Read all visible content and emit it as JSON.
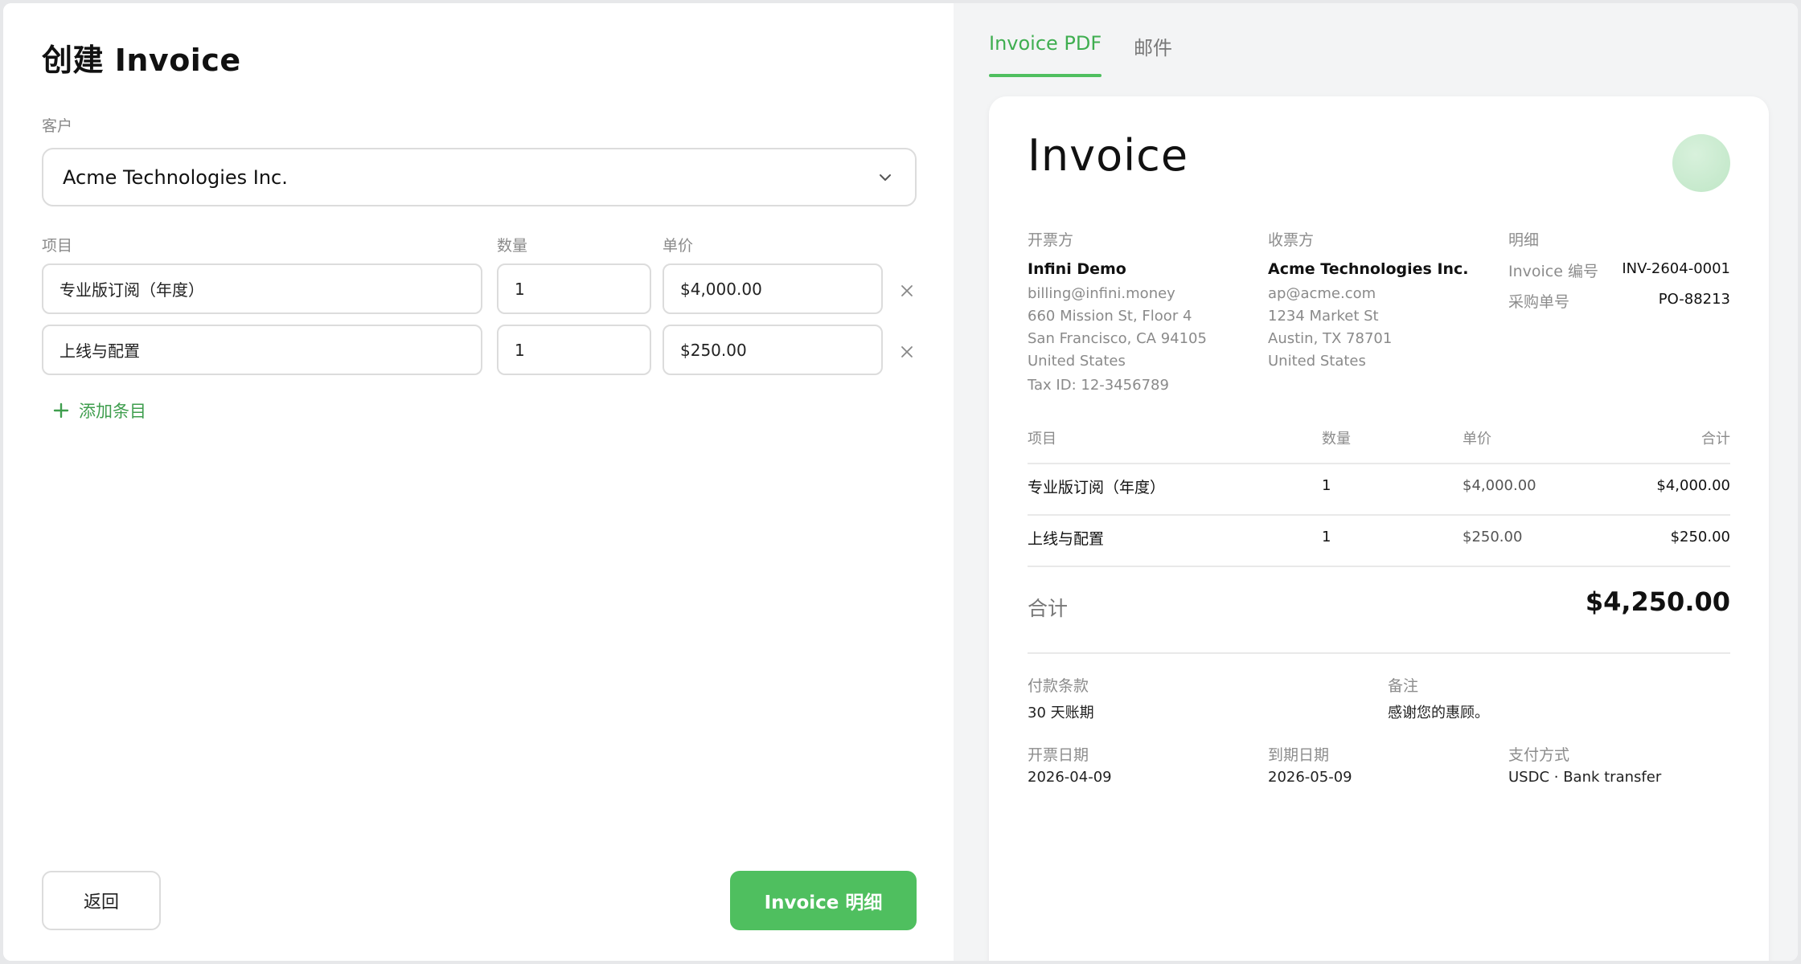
{
  "form": {
    "title": "创建 Invoice",
    "customer_label": "客户",
    "customer_value": "Acme Technologies Inc.",
    "col_item": "项目",
    "col_qty": "数量",
    "col_unit_price": "单价",
    "rows": [
      {
        "item": "专业版订阅（年度）",
        "qty": "1",
        "price": "$4,000.00"
      },
      {
        "item": "上线与配置",
        "qty": "1",
        "price": "$250.00"
      }
    ],
    "add_item_label": "添加条目",
    "back_label": "返回",
    "primary_label": "Invoice 明细"
  },
  "preview": {
    "tabs": [
      "Invoice PDF",
      "邮件"
    ],
    "active_tab": "Invoice PDF",
    "title": "Invoice",
    "from": {
      "heading": "开票方",
      "name": "Infini Demo",
      "lines": [
        "billing@infini.money",
        "660 Mission St, Floor 4",
        "San Francisco, CA 94105",
        "United States",
        "Tax ID: 12-3456789"
      ]
    },
    "to": {
      "heading": "收票方",
      "name": "Acme Technologies Inc.",
      "lines": [
        "ap@acme.com",
        "1234 Market St",
        "Austin, TX 78701",
        "United States"
      ]
    },
    "details": {
      "heading": "明细",
      "invoice_no_label": "Invoice 编号",
      "invoice_no": "INV-2604-0001",
      "po_label": "采购单号",
      "po": "PO-88213"
    },
    "table": {
      "headers": [
        "项目",
        "数量",
        "单价",
        "合计"
      ],
      "rows": [
        {
          "item": "专业版订阅（年度）",
          "qty": "1",
          "price": "$4,000.00",
          "total": "$4,000.00"
        },
        {
          "item": "上线与配置",
          "qty": "1",
          "price": "$250.00",
          "total": "$250.00"
        }
      ]
    },
    "total_label": "合计",
    "total_value": "$4,250.00",
    "payment_terms_label": "付款条款",
    "payment_terms": "30 天账期",
    "notes_label": "备注",
    "notes": "感谢您的惠顾。",
    "issue_date_label": "开票日期",
    "issue_date": "2026-04-09",
    "due_date_label": "到期日期",
    "due_date": "2026-05-09",
    "payment_method_label": "支付方式",
    "payment_method": "USDC · Bank transfer"
  },
  "colors": {
    "accent": "#4fbf5f",
    "accent_text": "#3fae50",
    "right_bg": "#f3f4f5"
  },
  "icons": [
    "chevron-down-icon",
    "close-icon",
    "plus-icon",
    "logo-circle"
  ]
}
